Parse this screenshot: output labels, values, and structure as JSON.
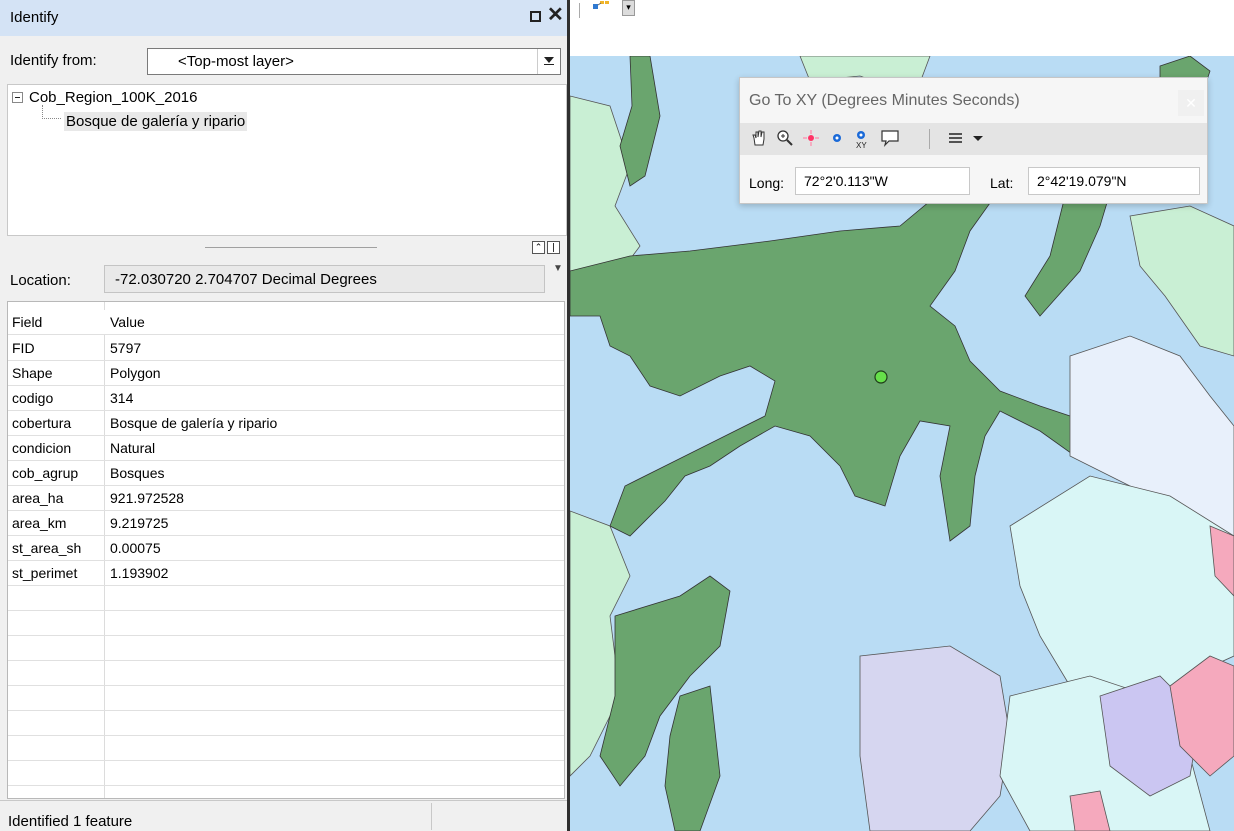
{
  "identify_panel": {
    "title": "Identify",
    "identify_from_label": "Identify from:",
    "identify_from_value": "<Top-most layer>",
    "tree": {
      "layer": "Cob_Region_100K_2016",
      "feature": "Bosque de galería y ripario"
    },
    "location_label": "Location:",
    "location_value": "-72.030720  2.704707 Decimal Degrees",
    "table": {
      "header": {
        "field": "Field",
        "value": "Value"
      },
      "rows": [
        {
          "field": "FID",
          "value": "5797"
        },
        {
          "field": "Shape",
          "value": "Polygon"
        },
        {
          "field": "codigo",
          "value": "314"
        },
        {
          "field": "cobertura",
          "value": "Bosque de galería y ripario"
        },
        {
          "field": "condicion",
          "value": "Natural"
        },
        {
          "field": "cob_agrup",
          "value": "Bosques"
        },
        {
          "field": "area_ha",
          "value": "921.972528"
        },
        {
          "field": "area_km",
          "value": "9.219725"
        },
        {
          "field": "st_area_sh",
          "value": "0.00075"
        },
        {
          "field": "st_perimet",
          "value": "1.193902"
        }
      ]
    },
    "status": "Identified 1 feature",
    "icons": {
      "restore": "restore-window-icon",
      "close": "close-icon",
      "dropdown": "chevron-down-icon",
      "collapse": "tree-collapse-icon"
    }
  },
  "goto_xy": {
    "title": "Go To XY    (Degrees Minutes Seconds)",
    "long_label": "Long:",
    "long_value": "72°2'0.113\"W",
    "lat_label": "Lat:",
    "lat_value": "2°42'19.079\"N",
    "tools": [
      "pan-icon",
      "zoom-icon",
      "flash-icon",
      "add-point-icon",
      "add-labeled-point-icon",
      "add-callout-icon",
      "units-menu-icon",
      "dropdown-icon"
    ]
  },
  "map": {
    "colors": {
      "water": "#b9dcf4",
      "forest": "#6aa56e",
      "light_green": "#c9efd4",
      "light_cyan": "#d9f6f6",
      "lavender": "#d6d6f0",
      "violet": "#cbc6f2",
      "pink": "#f5a9bd",
      "pale": "#e8f0fb"
    },
    "identified_point_color": "#66e04a"
  }
}
